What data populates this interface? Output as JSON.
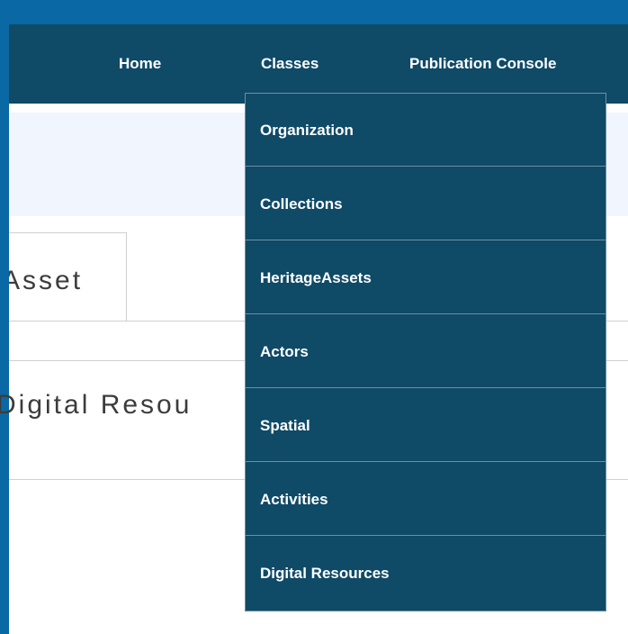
{
  "nav": {
    "home": "Home",
    "classes": "Classes",
    "publication_console": "Publication Console"
  },
  "content": {
    "tab_label": "Asset",
    "row_label": "Digital Resou"
  },
  "dropdown": {
    "items": [
      "Organization",
      "Collections",
      "HeritageAssets",
      "Actors",
      "Spatial",
      "Activities",
      "Digital Resources"
    ]
  }
}
